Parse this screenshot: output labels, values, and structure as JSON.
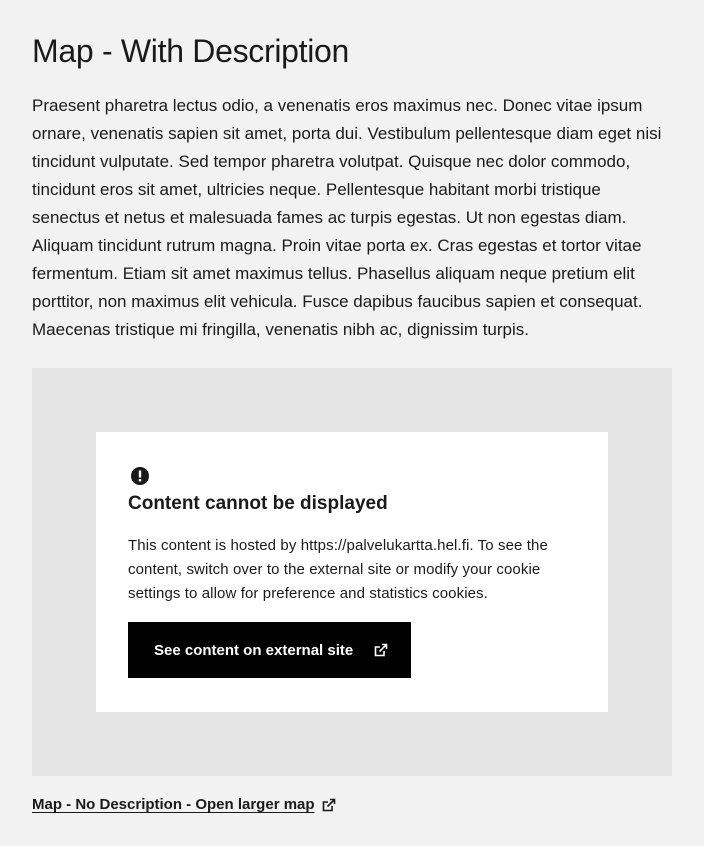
{
  "heading": "Map - With Description",
  "description": "Praesent pharetra lectus odio, a venenatis eros maximus nec. Donec vitae ipsum ornare, venenatis sapien sit amet, porta dui. Vestibulum pellentesque diam eget nisi tincidunt vulputate. Sed tempor pharetra volutpat. Quisque nec dolor commodo, tincidunt eros sit amet, ultricies neque. Pellentesque habitant morbi tristique senectus et netus et malesuada fames ac turpis egestas. Ut non egestas diam. Aliquam tincidunt rutrum magna. Proin vitae porta ex. Cras egestas et tortor vitae fermentum. Etiam sit amet maximus tellus. Phasellus aliquam neque pretium elit porttitor, non maximus elit vehicula. Fusce dapibus faucibus sapien et consequat. Maecenas tristique mi fringilla, venenatis nibh ac, dignissim turpis.",
  "notice": {
    "icon": "alert-circle-icon",
    "title": "Content cannot be displayed",
    "text": "This content is hosted by https://palvelukartta.hel.fi. To see the content, switch over to the external site or modify your cookie settings to allow for preference and statistics cookies.",
    "button_label": "See content on external site",
    "button_icon": "external-link-icon"
  },
  "map_link": {
    "label": "Map - No Description - Open larger map",
    "icon": "external-link-icon"
  },
  "colors": {
    "page_bg": "#f2f2f2",
    "map_bg": "#e5e5e5",
    "notice_bg": "#ffffff",
    "button_bg": "#000000",
    "text": "#1a1a1a"
  }
}
